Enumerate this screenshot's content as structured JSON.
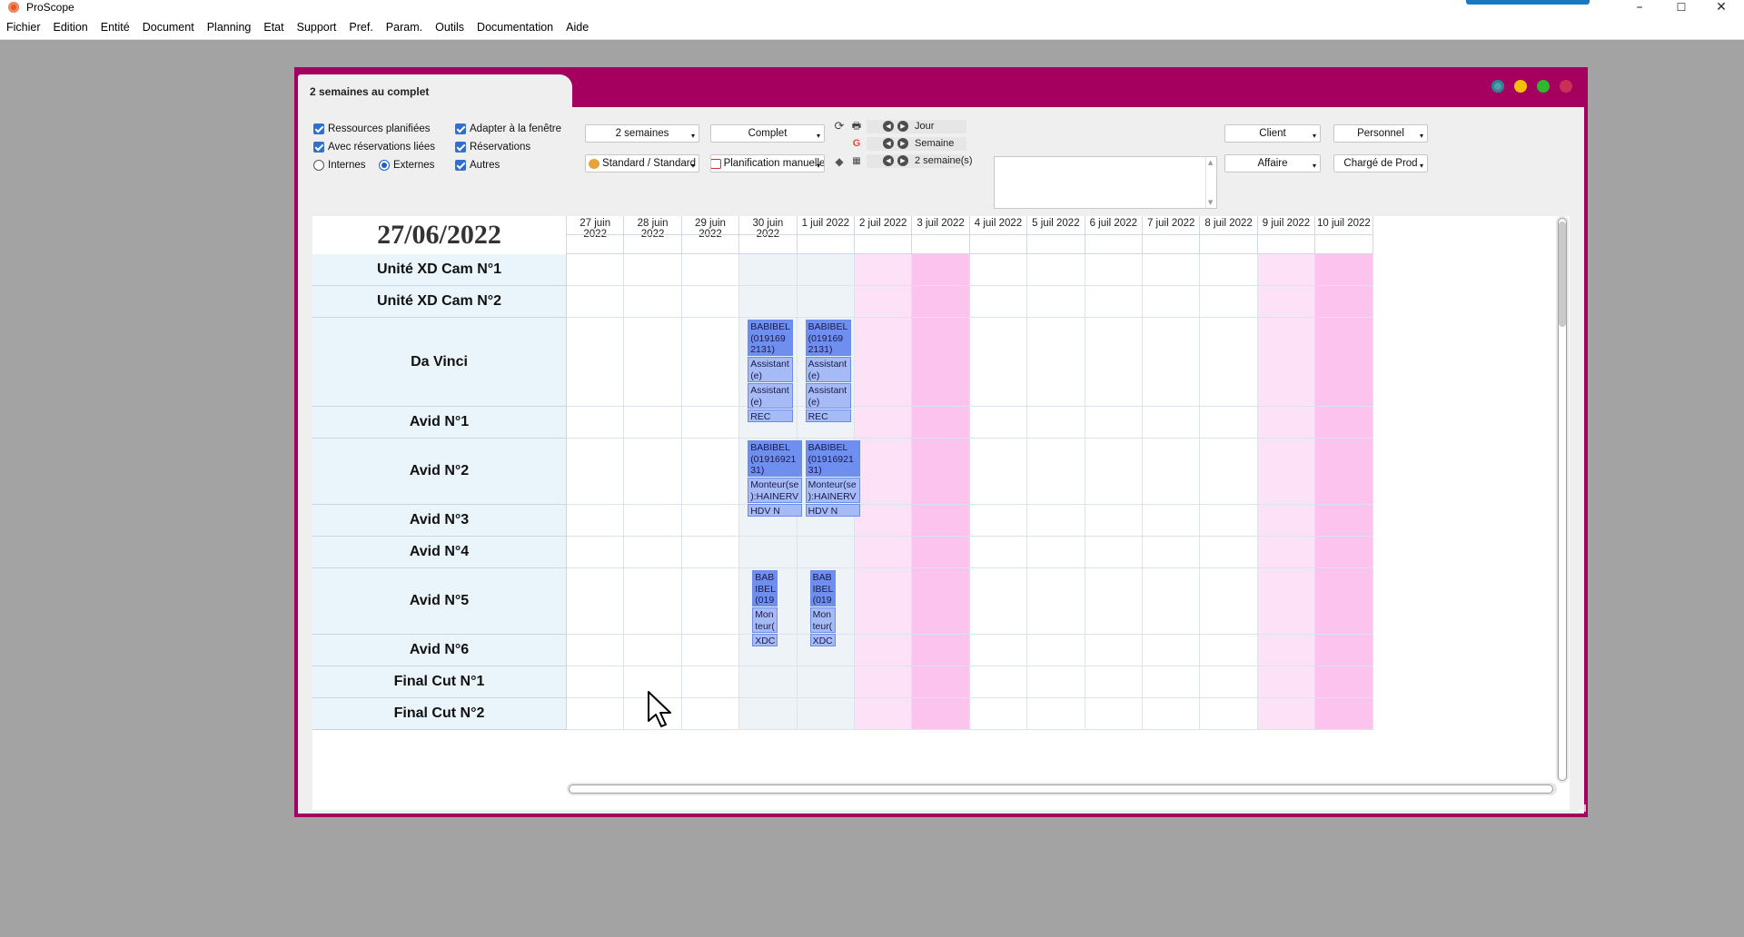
{
  "app": {
    "title": "ProScope",
    "icon": "proscope-logo-icon"
  },
  "window_controls": {
    "minimize": "–",
    "maximize": "☐",
    "close": "✕"
  },
  "menu": [
    "Fichier",
    "Edition",
    "Entité",
    "Document",
    "Planning",
    "Etat",
    "Support",
    "Pref.",
    "Param.",
    "Outils",
    "Documentation",
    "Aide"
  ],
  "document": {
    "tab_title": "2 semaines au complet",
    "frame_color": "#a5005f",
    "title_dots": [
      "#4aa3a3",
      "#f2c200",
      "#2eb82e",
      "#e05050"
    ]
  },
  "options": {
    "ressources_planifiees": "Ressources planifiées",
    "avec_reservations_liees": "Avec réservations liées",
    "internes": "Internes",
    "externes": "Externes",
    "adapter_fenetre": "Adapter à la fenêtre",
    "reservations": "Réservations",
    "autres": "Autres"
  },
  "dropdowns": {
    "periode": "2 semaines",
    "affichage": "Complet",
    "modele": "Standard / Standard",
    "planification": "Planification manuelle",
    "client": "Client",
    "personnel": "Personnel",
    "affaire": "Affaire",
    "charge_de_prod": "Chargé de Prod"
  },
  "nav": {
    "jour": "Jour",
    "semaine": "Semaine",
    "semaines": "2 semaine(s)"
  },
  "planning": {
    "current_date": "27/06/2022",
    "days": [
      "27 juin 2022",
      "28 juin 2022",
      "29 juin 2022",
      "30 juin 2022",
      "1 juil 2022",
      "2 juil 2022",
      "3 juil 2022",
      "4 juil 2022",
      "5 juil 2022",
      "6 juil 2022",
      "7 juil 2022",
      "8 juil 2022",
      "9 juil 2022",
      "10 juil 2022"
    ],
    "resources": [
      "Unité XD Cam N°1",
      "Unité XD Cam N°2",
      "Da Vinci",
      "Avid N°1",
      "Avid N°2",
      "Avid N°3",
      "Avid N°4",
      "Avid N°5",
      "Avid N°6",
      "Final Cut N°1",
      "Final Cut N°2"
    ],
    "events": {
      "davinci_main": "BABIBEL\n(019169\n2131)",
      "davinci_role1": "Assistant\n(e)",
      "davinci_role2": "Assistant\n(e)",
      "davinci_tag": "REC",
      "avid2_main": "BABIBEL\n(01916921\n31)",
      "avid2_role": "Monteur(se\n):HAINERV",
      "avid2_tag": "HDV N",
      "avid5_main": "BAB\nIBEL\n(019",
      "avid5_role": "Mon\nteur(",
      "avid5_tag": "XDC"
    }
  }
}
